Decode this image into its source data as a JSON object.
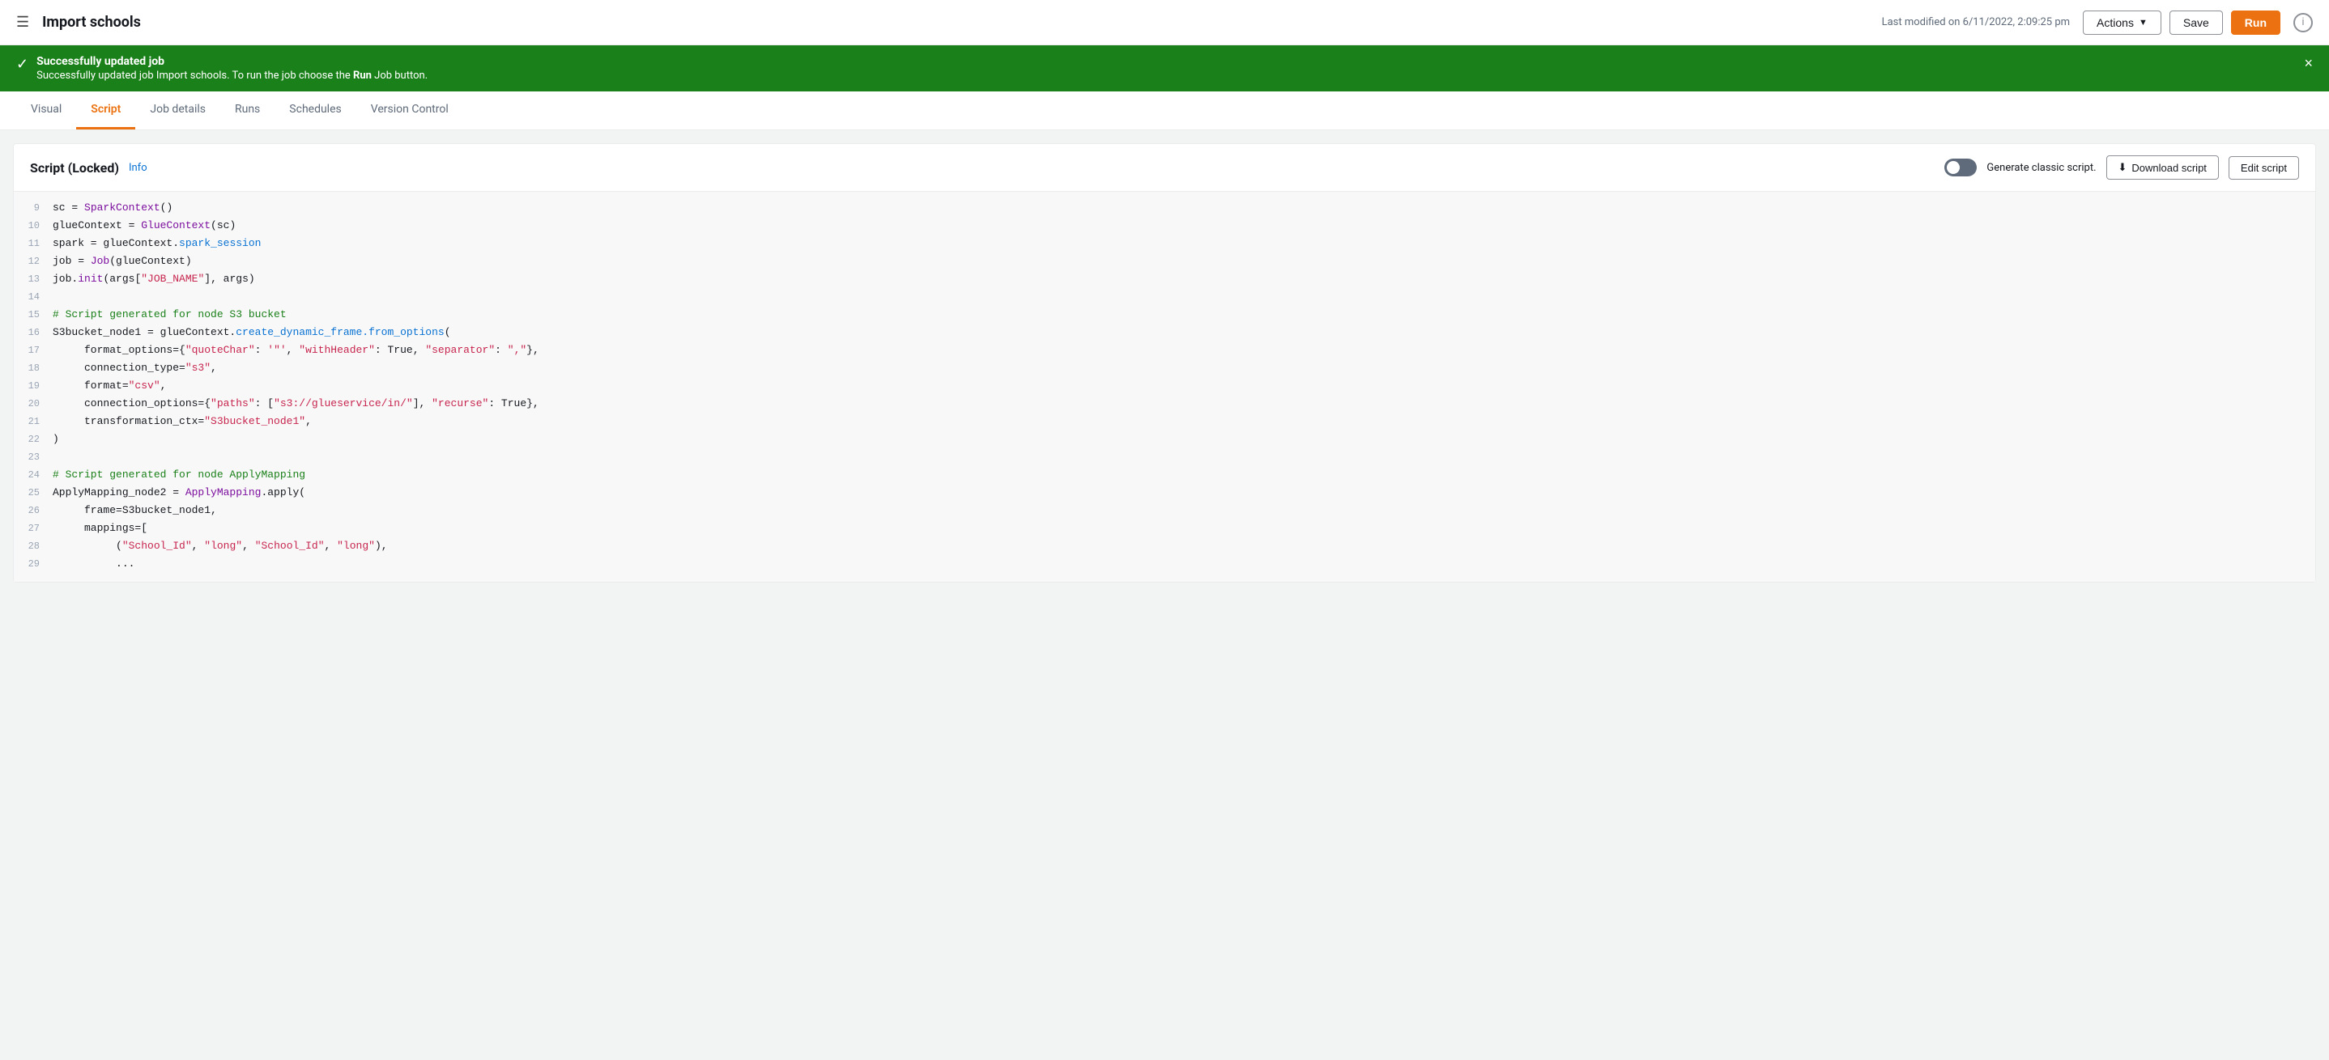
{
  "header": {
    "menu_icon": "☰",
    "title": "Import schools",
    "meta": "Last modified on 6/11/2022, 2:09:25 pm",
    "actions_label": "Actions",
    "save_label": "Save",
    "run_label": "Run",
    "info_icon": "i"
  },
  "banner": {
    "title": "Successfully updated job",
    "text_before_bold": "Successfully updated job Import schools. To run the job choose the ",
    "text_bold": "Run",
    "text_after_bold": " Job button.",
    "close_icon": "×"
  },
  "tabs": [
    {
      "id": "visual",
      "label": "Visual",
      "active": false
    },
    {
      "id": "script",
      "label": "Script",
      "active": true
    },
    {
      "id": "job-details",
      "label": "Job details",
      "active": false
    },
    {
      "id": "runs",
      "label": "Runs",
      "active": false
    },
    {
      "id": "schedules",
      "label": "Schedules",
      "active": false
    },
    {
      "id": "version-control",
      "label": "Version Control",
      "active": false
    }
  ],
  "script_panel": {
    "title": "Script (Locked)",
    "info_link": "Info",
    "generate_classic_label": "Generate classic script.",
    "download_label": "Download script",
    "edit_label": "Edit script"
  },
  "code_lines": [
    {
      "num": "9",
      "content": "sc = SparkContext()"
    },
    {
      "num": "10",
      "content": "glueContext = GlueContext(sc)"
    },
    {
      "num": "11",
      "content": "spark = glueContext.spark_session"
    },
    {
      "num": "12",
      "content": "job = Job(glueContext)"
    },
    {
      "num": "13",
      "content": "job.init(args[\"JOB_NAME\"], args)"
    },
    {
      "num": "14",
      "content": ""
    },
    {
      "num": "15",
      "content": "# Script generated for node S3 bucket"
    },
    {
      "num": "16",
      "content": "S3bucket_node1 = glueContext.create_dynamic_frame.from_options("
    },
    {
      "num": "17",
      "content": "     format_options={\"quoteChar\": '\"', \"withHeader\": True, \"separator\": \",\"},"
    },
    {
      "num": "18",
      "content": "     connection_type=\"s3\","
    },
    {
      "num": "19",
      "content": "     format=\"csv\","
    },
    {
      "num": "20",
      "content": "     connection_options={\"paths\": [\"s3://glueservice/in/\"], \"recurse\": True},"
    },
    {
      "num": "21",
      "content": "     transformation_ctx=\"S3bucket_node1\","
    },
    {
      "num": "22",
      "content": ")"
    },
    {
      "num": "23",
      "content": ""
    },
    {
      "num": "24",
      "content": "# Script generated for node ApplyMapping"
    },
    {
      "num": "25",
      "content": "ApplyMapping_node2 = ApplyMapping.apply("
    },
    {
      "num": "26",
      "content": "     frame=S3bucket_node1,"
    },
    {
      "num": "27",
      "content": "     mappings=["
    },
    {
      "num": "28",
      "content": "          (\"School_Id\", \"long\", \"School_Id\", \"long\"),"
    },
    {
      "num": "29",
      "content": "          ..."
    }
  ]
}
